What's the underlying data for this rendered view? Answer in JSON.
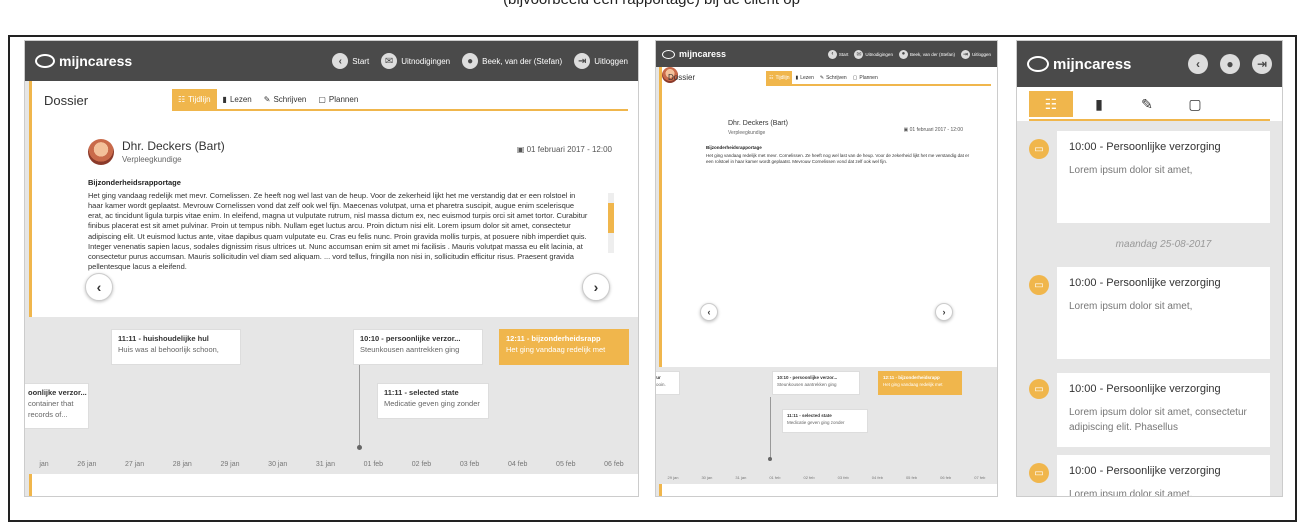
{
  "caption": "(bijvoorbeeld een rapportage) bij de client op",
  "app": {
    "logo_text": "mijncaress",
    "accent": "#f0b64c",
    "topbar_color": "#4a4a4a"
  },
  "panel1": {
    "nav": [
      {
        "label": "Start",
        "icon": "back-arrow-icon"
      },
      {
        "label": "Uitnodigingen",
        "icon": "invite-icon"
      },
      {
        "label": "Beek, van der (Stefan)",
        "icon": "user-icon"
      },
      {
        "label": "Uitloggen",
        "icon": "logout-icon"
      }
    ],
    "dossier_title": "Dossier",
    "tabs": [
      {
        "label": "Tijdlijn",
        "icon": "timeline-icon",
        "active": true
      },
      {
        "label": "Lezen",
        "icon": "book-icon"
      },
      {
        "label": "Schrijven",
        "icon": "pencil-icon"
      },
      {
        "label": "Plannen",
        "icon": "calendar-icon"
      }
    ],
    "report": {
      "name": "Dhr. Deckers (Bart)",
      "role": "Verpleegkundige",
      "date": "01 februari 2017 - 12:00",
      "title": "Bijzonderheidsrapportage",
      "body": "Het ging vandaag redelijk met mevr. Cornelissen. Ze heeft nog wel last van de heup. Voor de zekerheid lijkt het me verstandig dat er een rolstoel in haar kamer wordt geplaatst. Mevrouw Cornelissen vond dat zelf ook wel fijn. Maecenas volutpat, urna et pharetra suscipit, augue enim scelerisque erat, ac tincidunt ligula turpis vitae enim. In eleifend, magna ut vulputate rutrum, nisl massa dictum ex, nec euismod turpis orci sit amet tortor. Curabitur finibus placerat est sit amet pulvinar. Proin ut tempus nibh. Nullam eget luctus arcu. Proin dictum nisi elit. Lorem ipsum dolor sit amet, consectetur adipiscing elit. Ut euismod luctus ante, vitae dapibus quam vulputate eu. Cras eu felis nunc. Proin gravida mollis turpis, at posuere nibh imperdiet quis. Integer venenatis sapien lacus, sodales dignissim risus ultrices ut. Nunc accumsan enim sit amet mi facilisis . Mauris volutpat massa eu elit lacinia, at consectetur purus accumsan. Mauris sollicitudin vel diam sed aliquam. ... vord tellus, fringilla non nisi in, sollicitudin efficitur risus. Praesent gravida pellentesque lacus a eleifend."
    },
    "timeline_cards": [
      {
        "title": "11:11 - huishoudelijke hul",
        "text": "Huis was al behoorlijk schoon,",
        "selected": false
      },
      {
        "title": "10:10 - persoonlijke verzor...",
        "text": "Steunkousen aantrekken ging",
        "selected": false
      },
      {
        "title": "12:11 - bijzonderheidsrapp",
        "text": "Het ging vandaag redelijk met",
        "selected": true
      },
      {
        "title": "oonlijke verzor...",
        "text": "container that",
        "text2": "records of...",
        "selected": false
      },
      {
        "title": "11:11 - selected state",
        "text": "Medicatie geven ging zonder",
        "selected": false
      }
    ],
    "axis": [
      "jan",
      "26 jan",
      "27 jan",
      "28 jan",
      "29 jan",
      "30 jan",
      "31 jan",
      "01 feb",
      "02 feb",
      "03 feb",
      "04 feb",
      "05 feb",
      "06 feb"
    ]
  },
  "panel2": {
    "nav": [
      {
        "label": "Start"
      },
      {
        "label": "Uitnodigingen"
      },
      {
        "label": "Beek, van der (Stefan)"
      },
      {
        "label": "Uitloggen"
      }
    ],
    "dossier_title": "Dossier",
    "tabs": [
      {
        "label": "Tijdlijn",
        "active": true
      },
      {
        "label": "Lezen"
      },
      {
        "label": "Schrijven"
      },
      {
        "label": "Plannen"
      }
    ],
    "report": {
      "name": "Dhr. Deckers (Bart)",
      "role": "Verpleegkundige",
      "date": "01 februari 2017 - 12:00",
      "title": "Bijzonderheidsrapportage",
      "body": "Het ging vandaag redelijk met mevr. Cornelissen. Ze heeft nog wel last van de heup. Voor de zekerheid lijkt het me verstandig dat er een rolstoel in haar kamer wordt geplaatst. Mevrouw Cornelissen vond dat zelf ook wel fijn."
    },
    "timeline_cards": [
      {
        "title": "10:10 - persoonlijke verzor...",
        "text": "Steunkousen aantrekken ging"
      },
      {
        "title": "12:11 - bijzonderheidsrapp",
        "text": "Het ging vandaag redelijk met",
        "selected": true
      },
      {
        "title": "11:11 - selected state",
        "text": "Medicatie geven ging zonder"
      },
      {
        "title": "ïur",
        "text": "iooin."
      }
    ],
    "axis": [
      "29 jan",
      "30 jan",
      "31 jan",
      "01 feb",
      "02 feb",
      "03 feb",
      "04 feb",
      "05 feb",
      "06 feb",
      "07 feb"
    ]
  },
  "panel3": {
    "tabs": [
      {
        "icon": "timeline-icon",
        "glyph": "☷",
        "active": true
      },
      {
        "icon": "book-icon",
        "glyph": "▮"
      },
      {
        "icon": "pencil-icon",
        "glyph": "✎"
      },
      {
        "icon": "calendar-icon",
        "glyph": "▢"
      }
    ],
    "feed": [
      {
        "title": "10:00 - Persoonlijke verzorging",
        "body": "Lorem ipsum dolor sit amet,"
      },
      {
        "date": "maandag 25-08-2017"
      },
      {
        "title": "10:00 - Persoonlijke verzorging",
        "body": "Lorem ipsum dolor sit amet,"
      },
      {
        "title": "10:00 - Persoonlijke verzorging",
        "body": "Lorem ipsum dolor sit amet, consectetur adipiscing elit. Phasellus"
      },
      {
        "title": "10:00 - Persoonlijke verzorging",
        "body": "Lorem ipsum dolor sit amet."
      }
    ]
  }
}
